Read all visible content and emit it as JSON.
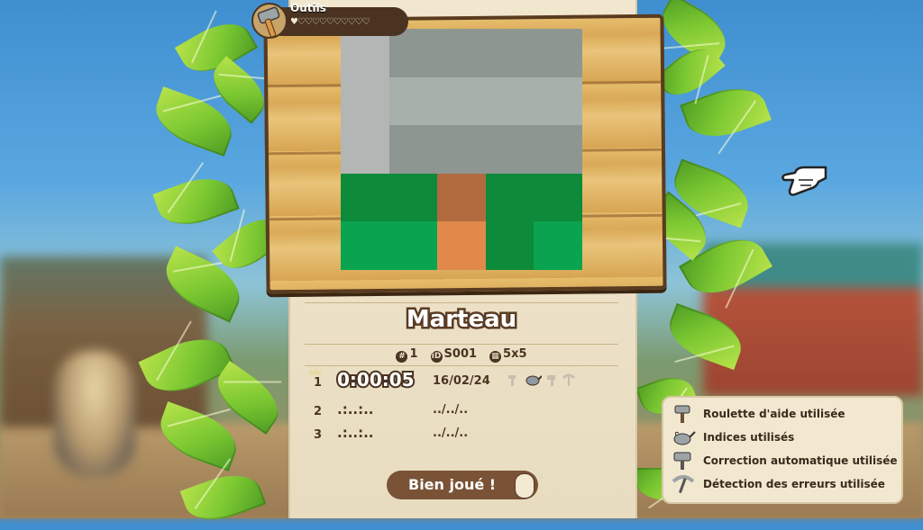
{
  "tool": {
    "name": "Outils",
    "hearts": "♥♡♡♡♡♡♡♡♡♡♡"
  },
  "puzzle": {
    "title": "Marteau",
    "number": "1",
    "id": "S001",
    "size": "5x5",
    "pixels": [
      [
        "#b3b6b4",
        "#8e9692",
        "#8e9692",
        "#8e9692",
        "#8e9692"
      ],
      [
        "#b3b6b4",
        "#a7b0ab",
        "#a7b0ab",
        "#a7b0ab",
        "#a7b0ab"
      ],
      [
        "#b3b6b4",
        "#8e9692",
        "#8e9692",
        "#8e9692",
        "#8e9692"
      ],
      [
        "#0d8a3a",
        "#0d8a3a",
        "#b06a3e",
        "#0d8a3a",
        "#0d8a3a"
      ],
      [
        "#0aa450",
        "#0aa450",
        "#e0894a",
        "#0d8a3a",
        "#0aa450"
      ]
    ]
  },
  "records": [
    {
      "rank": "1",
      "time": "0:00:05",
      "date": "16/02/24"
    },
    {
      "rank": "2",
      "time": ".:..:..",
      "date": "../../.."
    },
    {
      "rank": "3",
      "time": ".:..:..",
      "date": "../../.."
    }
  ],
  "ok_button": {
    "label": "Bien joué !"
  },
  "legend": [
    {
      "icon": "hammer-icon",
      "label": "Roulette d'aide utilisée"
    },
    {
      "icon": "watering-can-icon",
      "label": "Indices utilisés"
    },
    {
      "icon": "hammer-icon",
      "label": "Correction automatique utilisée"
    },
    {
      "icon": "pickaxe-icon",
      "label": "Détection des erreurs utilisée"
    }
  ]
}
